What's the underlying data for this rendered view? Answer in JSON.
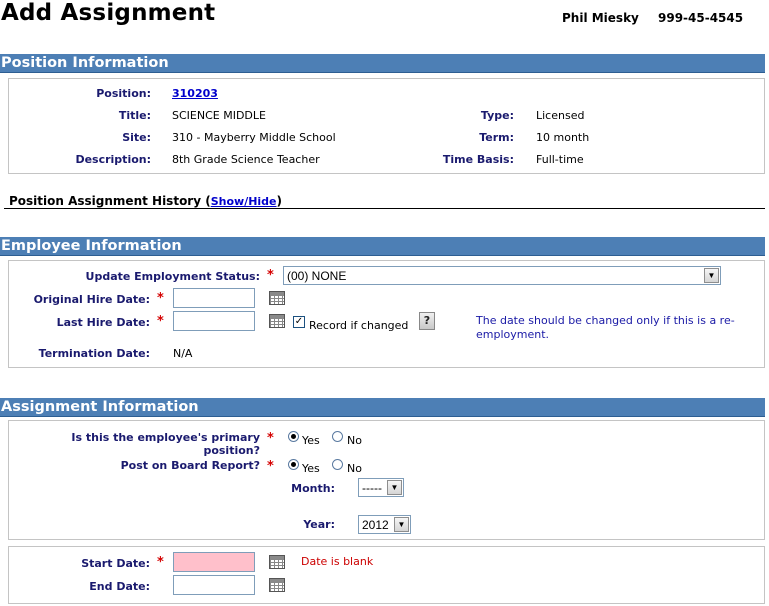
{
  "page": {
    "title": "Add Assignment",
    "employee_name": "Phil Miesky",
    "employee_id": "999-45-4545"
  },
  "position": {
    "section_title": "Position Information",
    "position_label": "Position:",
    "position_value": "310203",
    "title_label": "Title:",
    "title_value": "SCIENCE MIDDLE",
    "site_label": "Site:",
    "site_value": "310 - Mayberry Middle School",
    "description_label": "Description:",
    "description_value": "8th Grade Science Teacher",
    "type_label": "Type:",
    "type_value": "Licensed",
    "term_label": "Term:",
    "term_value": "10 month",
    "time_basis_label": "Time Basis:",
    "time_basis_value": "Full-time",
    "history_label": "Position Assignment History (",
    "history_link": "Show/Hide",
    "history_close": ")"
  },
  "employee": {
    "section_title": "Employee Information",
    "update_status_label": "Update Employment Status:",
    "update_status_value": "(00) NONE",
    "original_hire_label": "Original Hire Date:",
    "original_hire_value": "",
    "last_hire_label": "Last Hire Date:",
    "last_hire_value": "",
    "record_if_changed_label": "Record if changed",
    "record_if_changed_checked": true,
    "help_label": "?",
    "note_line1": "The date should be changed only if this is a re-",
    "note_line2": "employment.",
    "termination_label": "Termination Date:",
    "termination_value": "N/A"
  },
  "assignment": {
    "section_title": "Assignment Information",
    "primary_label_line1": "Is this the employee's primary",
    "primary_label_line2": "position?",
    "primary_yes": "Yes",
    "primary_no": "No",
    "primary_selected": "Yes",
    "board_label": "Post on Board Report?",
    "board_yes": "Yes",
    "board_no": "No",
    "board_selected": "Yes",
    "month_label": "Month:",
    "month_value": "-----",
    "year_label": "Year:",
    "year_value": "2012",
    "start_date_label": "Start Date:",
    "start_date_value": "",
    "start_date_error": "Date is blank",
    "end_date_label": "End Date:",
    "end_date_value": ""
  },
  "required_marker": "*",
  "colors": {
    "section_bar": "#4d7fb5",
    "label_text": "#1a1a6e",
    "required": "#d40000",
    "error_field": "#ffc0cb",
    "note_text": "#1a1aa6"
  }
}
